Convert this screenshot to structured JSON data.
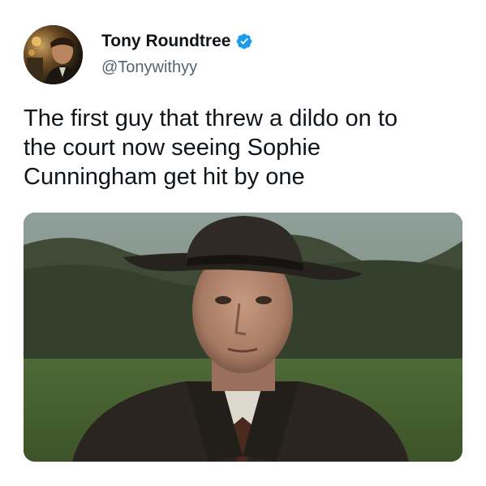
{
  "author": {
    "display_name": "Tony Roundtree",
    "handle": "@Tonywithyy",
    "verified": true,
    "verified_icon": "verified-badge-icon",
    "avatar": "profile-photo"
  },
  "tweet": {
    "lines": [
      "The first guy that threw a dildo on to",
      "the court now seeing Sophie",
      "Cunningham get hit by one"
    ]
  },
  "media": {
    "kind": "image",
    "description_icon": "photo-of-man-in-fedora"
  },
  "colors": {
    "name": "#0f1419",
    "handle": "#536471",
    "verified": "#1d9bf0"
  }
}
